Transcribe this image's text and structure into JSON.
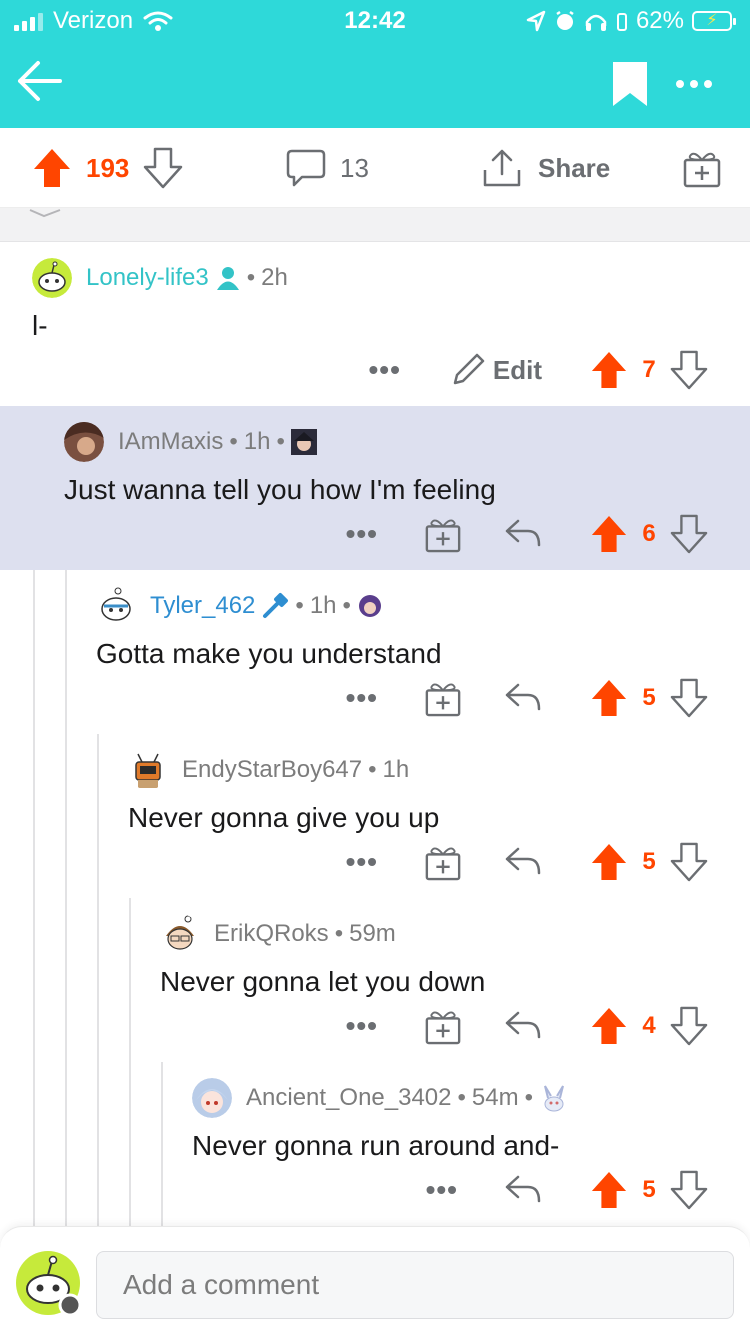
{
  "status_bar": {
    "carrier": "Verizon",
    "time": "12:42",
    "battery": "62%"
  },
  "colors": {
    "header": "#2ed9d9",
    "upvote": "#ff4500",
    "highlight": "#dde0ef"
  },
  "post_actions": {
    "score": "193",
    "comments": "13",
    "share_label": "Share"
  },
  "comments": [
    {
      "username": "Lonely-life3",
      "role": "op",
      "age": "2h",
      "body": "l-",
      "edit_label": "Edit",
      "score": "7"
    },
    {
      "username": "IAmMaxis",
      "age": "1h",
      "body": "Just wanna tell you how I'm feeling",
      "score": "6"
    },
    {
      "username": "Tyler_462",
      "role": "mod",
      "age": "1h",
      "body": "Gotta make you understand",
      "score": "5"
    },
    {
      "username": "EndyStarBoy647",
      "age": "1h",
      "body": "Never gonna give you up",
      "score": "5"
    },
    {
      "username": "ErikQRoks",
      "age": "59m",
      "body": "Never gonna let you down",
      "score": "4"
    },
    {
      "username": "Ancient_One_3402",
      "age": "54m",
      "body": "Never gonna run around and-",
      "score": "5"
    }
  ],
  "composer": {
    "placeholder": "Add a comment"
  },
  "separators": {
    "dot": "•"
  }
}
